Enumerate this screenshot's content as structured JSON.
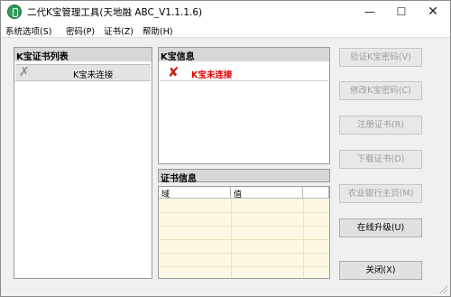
{
  "window": {
    "title": "二代K宝管理工具(天地融 ABC_V1.1.1.6)",
    "minimize_glyph": "—",
    "maximize_glyph": "☐",
    "close_glyph": "✕"
  },
  "menu": {
    "items": [
      {
        "label": "系统选项(S)"
      },
      {
        "label": "密码(P)"
      },
      {
        "label": "证书(Z)"
      },
      {
        "label": "帮助(H)"
      }
    ]
  },
  "cert_list": {
    "header": "K宝证书列表",
    "rows": [
      {
        "label": "K宝未连接",
        "icon": "x-mark-icon"
      }
    ]
  },
  "key_info": {
    "header": "K宝信息",
    "status": "K宝未连接",
    "status_color": "#e00000",
    "icon": "red-x-icon"
  },
  "cert_info": {
    "header": "证书信息",
    "columns": [
      "域",
      "值",
      ""
    ]
  },
  "buttons": [
    {
      "label": "验证K宝密码(V)",
      "enabled": false
    },
    {
      "label": "修改K宝密码(C)",
      "enabled": false
    },
    {
      "label": "注册证书(R)",
      "enabled": false
    },
    {
      "label": "下载证书(D)",
      "enabled": false
    },
    {
      "label": "农业银行主页(M)",
      "enabled": false
    },
    {
      "label": "在线升级(U)",
      "enabled": true
    },
    {
      "label": "关闭(X)",
      "enabled": true
    }
  ],
  "colors": {
    "app_icon": "#2f9c58",
    "panel_header": "#d7d7d7",
    "table_background": "#fdf8e4"
  }
}
